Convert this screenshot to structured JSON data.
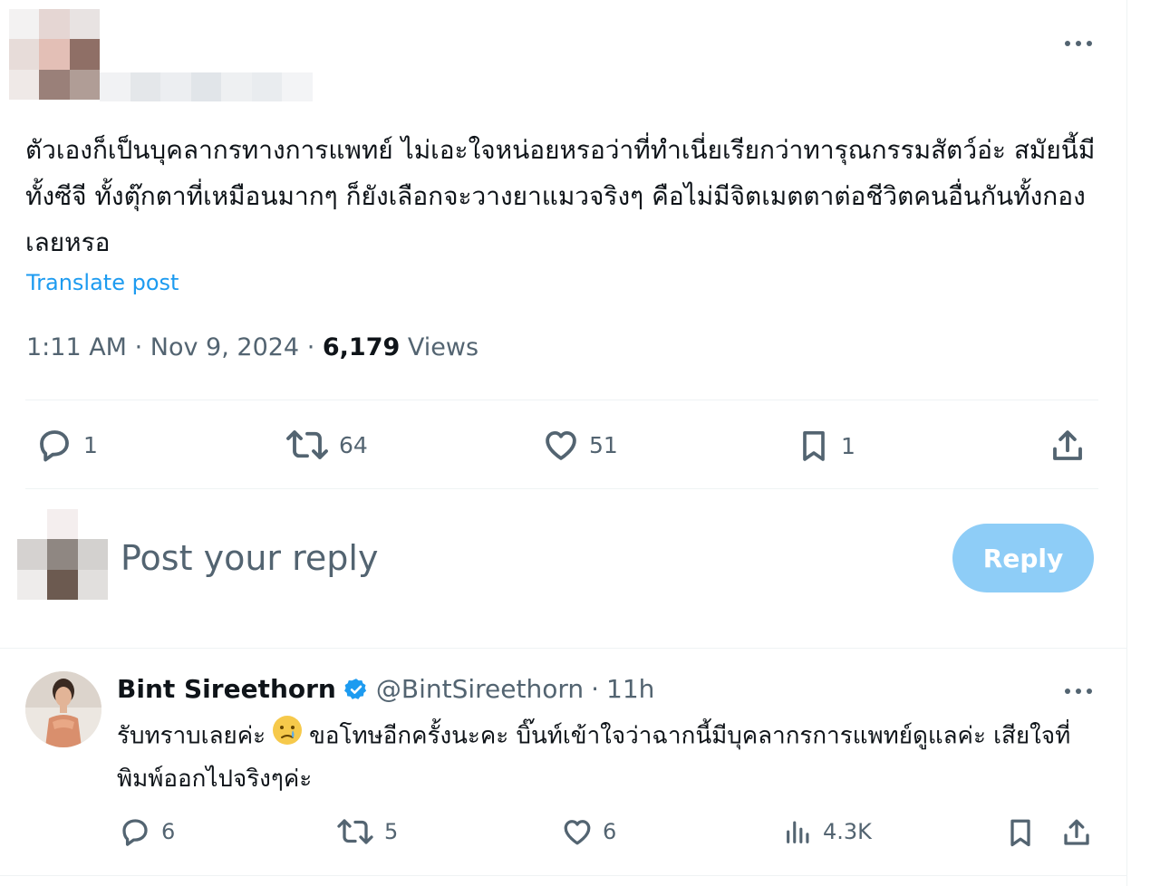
{
  "main_tweet": {
    "text": "ตัวเองก็เป็นบุคลากรทางการแพทย์ ไม่เอะใจหน่อยหรอว่าที่ทำเนี่ยเรียกว่าทารุณกรรมสัตว์อ่ะ สมัยนี้มีทั้งซีจี ทั้งตุ๊กตาที่เหมือนมากๆ ก็ยังเลือกจะวางยาแมวจริงๆ คือไม่มีจิตเมตตาต่อชีวิตคนอื่นกันทั้งกองเลยหรอ",
    "translate_label": "Translate post",
    "time": "1:11 AM",
    "separator": "·",
    "date": "Nov 9, 2024",
    "views_count": "6,179",
    "views_label": "Views",
    "actions": {
      "replies": "1",
      "retweets": "64",
      "likes": "51",
      "bookmarks": "1"
    }
  },
  "composer": {
    "placeholder": "Post your reply",
    "button_label": "Reply"
  },
  "reply_tweet": {
    "display_name": "Bint Sireethorn",
    "handle": "@BintSireethorn",
    "separator": "·",
    "time": "11h",
    "text_part1": "รับทราบเลยค่ะ",
    "text_part2": "ขอโทษอีกครั้งนะคะ บิ๊นท์เข้าใจว่าฉากนี้มีบุคลากรการแพทย์ดูแลค่ะ เสียใจที่พิมพ์ออกไปจริงๆค่ะ",
    "actions": {
      "replies": "6",
      "retweets": "5",
      "likes": "6",
      "views": "4.3K"
    }
  },
  "colors": {
    "text_primary": "#0f1419",
    "text_secondary": "#536471",
    "accent": "#1d9bf0",
    "reply_button_disabled": "#8ecdf7",
    "divider": "#eff3f4",
    "verified": "#1d9bf0"
  },
  "icons": {
    "more": "more-horizontal-icon",
    "reply": "reply-bubble-icon",
    "retweet": "retweet-icon",
    "like": "heart-icon",
    "bookmark": "bookmark-icon",
    "share": "share-icon",
    "views": "bar-chart-icon",
    "verified": "verified-badge-icon",
    "emoji": "crying-face-emoji-icon"
  }
}
